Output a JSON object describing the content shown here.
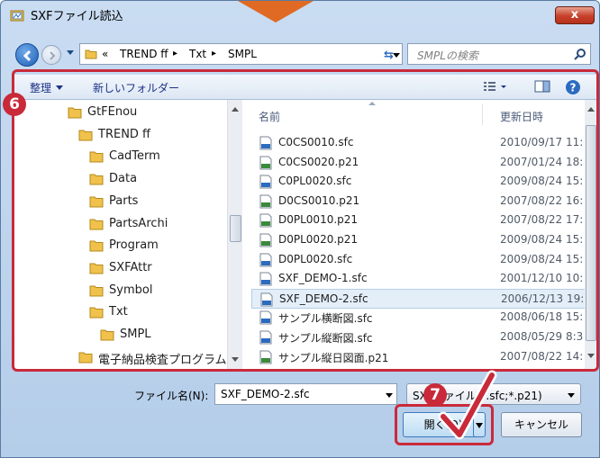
{
  "window": {
    "title": "SXFファイル読込",
    "close_label": "x"
  },
  "address_bar": {
    "crumbs": [
      "«",
      "TREND ff",
      "▸",
      "Txt",
      "▸",
      "SMPL"
    ]
  },
  "search": {
    "placeholder": "SMPLの検索"
  },
  "toolbar": {
    "organize_label": "整理",
    "new_folder_label": "新しいフォルダー"
  },
  "tree": {
    "items": [
      {
        "label": "GtFEnou"
      },
      {
        "label": "TREND ff"
      },
      {
        "label": "CadTerm"
      },
      {
        "label": "Data"
      },
      {
        "label": "Parts"
      },
      {
        "label": "PartsArchi"
      },
      {
        "label": "Program"
      },
      {
        "label": "SXFAttr"
      },
      {
        "label": "Symbol"
      },
      {
        "label": "Txt"
      },
      {
        "label": "SMPL"
      },
      {
        "label": "電子納品検査プログラム"
      }
    ]
  },
  "file_list": {
    "columns": {
      "name": "名前",
      "date": "更新日時"
    },
    "rows": [
      {
        "name": "C0CS0010.sfc",
        "date": "2010/09/17 11:",
        "type": "sfc"
      },
      {
        "name": "C0CS0020.p21",
        "date": "2007/01/24 18:",
        "type": "p21"
      },
      {
        "name": "C0PL0020.sfc",
        "date": "2009/08/24 15:",
        "type": "sfc"
      },
      {
        "name": "D0CS0010.p21",
        "date": "2007/08/22 16:",
        "type": "p21"
      },
      {
        "name": "D0PL0010.p21",
        "date": "2007/08/22 17:",
        "type": "p21"
      },
      {
        "name": "D0PL0020.p21",
        "date": "2009/08/24 15:",
        "type": "p21"
      },
      {
        "name": "D0PL0020.sfc",
        "date": "2009/08/24 15:",
        "type": "sfc"
      },
      {
        "name": "SXF_DEMO-1.sfc",
        "date": "2001/12/10 10:",
        "type": "sfc"
      },
      {
        "name": "SXF_DEMO-2.sfc",
        "date": "2006/12/13 19:",
        "type": "sfc"
      },
      {
        "name": "サンプル横断図.sfc",
        "date": "2008/06/18 15:",
        "type": "sfc"
      },
      {
        "name": "サンプル縦断図.sfc",
        "date": "2008/05/29 8:3",
        "type": "sfc"
      },
      {
        "name": "サンプル縦日図面.p21",
        "date": "2007/08/22 14:",
        "type": "p21"
      }
    ],
    "selected_index": 8
  },
  "bottom": {
    "filename_label": "ファイル名(N):",
    "filename_value": "SXF_DEMO-2.sfc",
    "filter_value": "SXFファイル(*.sfc;*.p21)",
    "open_label": "開く(O)",
    "cancel_label": "キャンセル"
  },
  "annotations": {
    "badge_6": "6",
    "badge_7": "7",
    "color": "#c92a3a"
  }
}
